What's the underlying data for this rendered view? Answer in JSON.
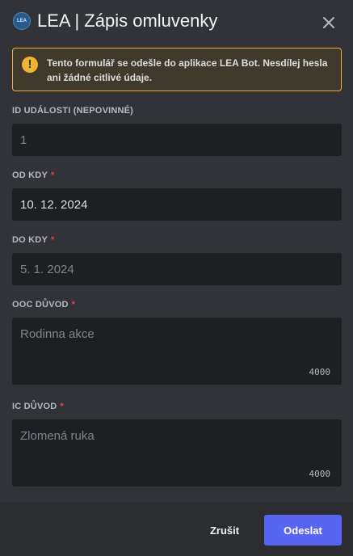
{
  "header": {
    "app_avatar_text": "LEA",
    "title": "LEA | Zápis omluvenky"
  },
  "notice": {
    "icon": "warning-icon",
    "text": "Tento formulář se odešle do aplikace LEA Bot. Nesdílej hesla ani žádné citlivé údaje."
  },
  "fields": {
    "event_id": {
      "label": "ID UDÁLOSTI (NEPOVINNÉ)",
      "placeholder": "1"
    },
    "from": {
      "label": "OD KDY",
      "required_marker": "*",
      "value": "10. 12. 2024"
    },
    "to": {
      "label": "DO KDY",
      "required_marker": "*",
      "placeholder": "5. 1. 2024"
    },
    "ooc_reason": {
      "label": "OOC DŮVOD",
      "required_marker": "*",
      "placeholder": "Rodinna akce",
      "counter": "4000"
    },
    "ic_reason": {
      "label": "IC DŮVOD",
      "required_marker": "*",
      "placeholder": "Zlomená ruka",
      "counter": "4000"
    }
  },
  "footer": {
    "cancel_label": "Zrušit",
    "submit_label": "Odeslat"
  },
  "colors": {
    "background": "#313338",
    "input_background": "#1e1f22",
    "notice_border": "#f0b232",
    "required": "#f23f43",
    "primary_button": "#5865f2"
  }
}
